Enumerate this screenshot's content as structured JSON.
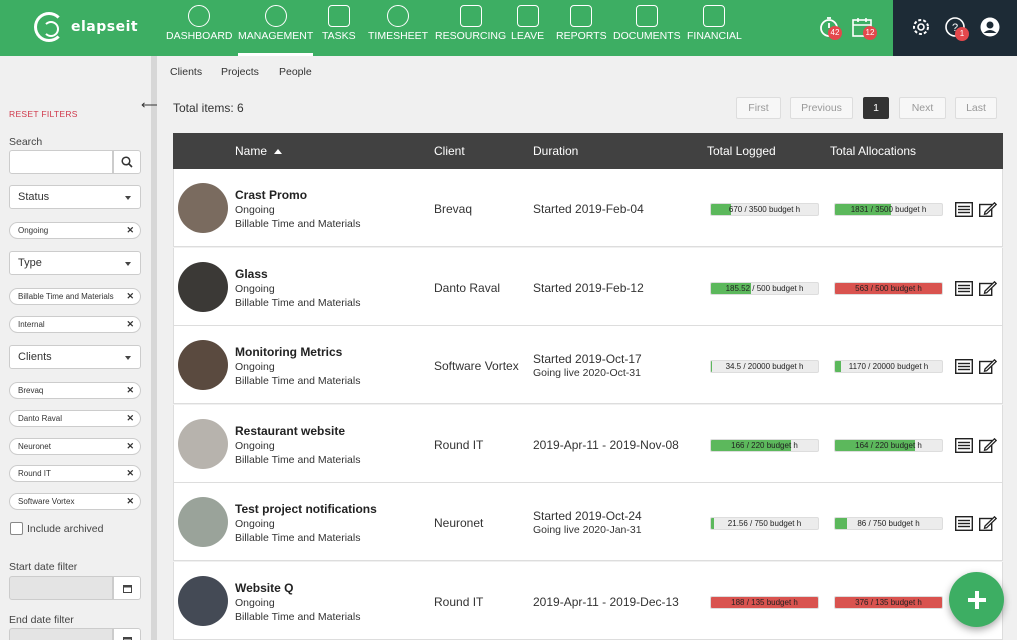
{
  "app": {
    "logo_text": "elapseit"
  },
  "nav": {
    "items": [
      {
        "label": "DASHBOARD"
      },
      {
        "label": "MANAGEMENT"
      },
      {
        "label": "TASKS"
      },
      {
        "label": "TIMESHEET"
      },
      {
        "label": "RESOURCING"
      },
      {
        "label": "LEAVE"
      },
      {
        "label": "REPORTS"
      },
      {
        "label": "DOCUMENTS"
      },
      {
        "label": "FINANCIAL"
      }
    ],
    "timer_badge": "42",
    "calendar_badge": "12",
    "help_badge": "1"
  },
  "subtabs": [
    {
      "label": "Clients"
    },
    {
      "label": "Projects"
    },
    {
      "label": "People"
    }
  ],
  "sidebar": {
    "reset_label": "RESET FILTERS",
    "search_label": "Search",
    "search_value": "",
    "status_label": "Status",
    "status_chips": [
      "Ongoing"
    ],
    "type_label": "Type",
    "type_chips": [
      "Billable Time and Materials",
      "Internal"
    ],
    "clients_label": "Clients",
    "client_chips": [
      "Brevaq",
      "Danto Raval",
      "Neuronet",
      "Round IT",
      "Software Vortex"
    ],
    "include_archived": "Include archived",
    "start_date_label": "Start date filter",
    "end_date_label": "End date filter"
  },
  "list": {
    "total_items": "Total items: 6",
    "pagination": {
      "first": "First",
      "previous": "Previous",
      "current": "1",
      "next": "Next",
      "last": "Last"
    },
    "columns": {
      "name": "Name",
      "client": "Client",
      "duration": "Duration",
      "logged": "Total Logged",
      "allocations": "Total Allocations"
    },
    "rows": [
      {
        "name": "Crast Promo",
        "status": "Ongoing",
        "billing": "Billable Time and Materials",
        "client": "Brevaq",
        "duration": "Started 2019-Feb-04",
        "duration_sub": "",
        "logged": "670 / 3500 budget h",
        "logged_fraction": 0.19,
        "logged_color": "#5cb85c",
        "alloc": "1831 / 3500 budget h",
        "alloc_fraction": 0.52,
        "alloc_color": "#5cb85c"
      },
      {
        "name": "Glass",
        "status": "Ongoing",
        "billing": "Billable Time and Materials",
        "client": "Danto Raval",
        "duration": "Started 2019-Feb-12",
        "duration_sub": "",
        "logged": "185.52 / 500 budget h",
        "logged_fraction": 0.37,
        "logged_color": "#5cb85c",
        "alloc": "563 / 500 budget h",
        "alloc_fraction": 1.0,
        "alloc_color": "#d9534f"
      },
      {
        "name": "Monitoring Metrics",
        "status": "Ongoing",
        "billing": "Billable Time and Materials",
        "client": "Software Vortex",
        "duration": "Started 2019-Oct-17",
        "duration_sub": "Going live 2020-Oct-31",
        "logged": "34.5 / 20000 budget h",
        "logged_fraction": 0.01,
        "logged_color": "#5cb85c",
        "alloc": "1170 / 20000 budget h",
        "alloc_fraction": 0.06,
        "alloc_color": "#5cb85c"
      },
      {
        "name": "Restaurant website",
        "status": "Ongoing",
        "billing": "Billable Time and Materials",
        "client": "Round IT",
        "duration": "2019-Apr-11 - 2019-Nov-08",
        "duration_sub": "",
        "logged": "166 / 220 budget h",
        "logged_fraction": 0.75,
        "logged_color": "#5cb85c",
        "alloc": "164 / 220 budget h",
        "alloc_fraction": 0.75,
        "alloc_color": "#5cb85c"
      },
      {
        "name": "Test project notifications",
        "status": "Ongoing",
        "billing": "Billable Time and Materials",
        "client": "Neuronet",
        "duration": "Started 2019-Oct-24",
        "duration_sub": "Going live 2020-Jan-31",
        "logged": "21.56 / 750 budget h",
        "logged_fraction": 0.03,
        "logged_color": "#5cb85c",
        "alloc": "86 / 750 budget h",
        "alloc_fraction": 0.11,
        "alloc_color": "#5cb85c"
      },
      {
        "name": "Website Q",
        "status": "Ongoing",
        "billing": "Billable Time and Materials",
        "client": "Round IT",
        "duration": "2019-Apr-11 - 2019-Dec-13",
        "duration_sub": "",
        "logged": "188 / 135 budget h",
        "logged_fraction": 1.0,
        "logged_color": "#d9534f",
        "alloc": "376 / 135 budget h",
        "alloc_fraction": 1.0,
        "alloc_color": "#d9534f"
      }
    ]
  },
  "colors": {
    "brand_green": "#3dae63",
    "dark_header": "#414141",
    "danger_red": "#d9534f",
    "badge_red": "#e4484c"
  }
}
